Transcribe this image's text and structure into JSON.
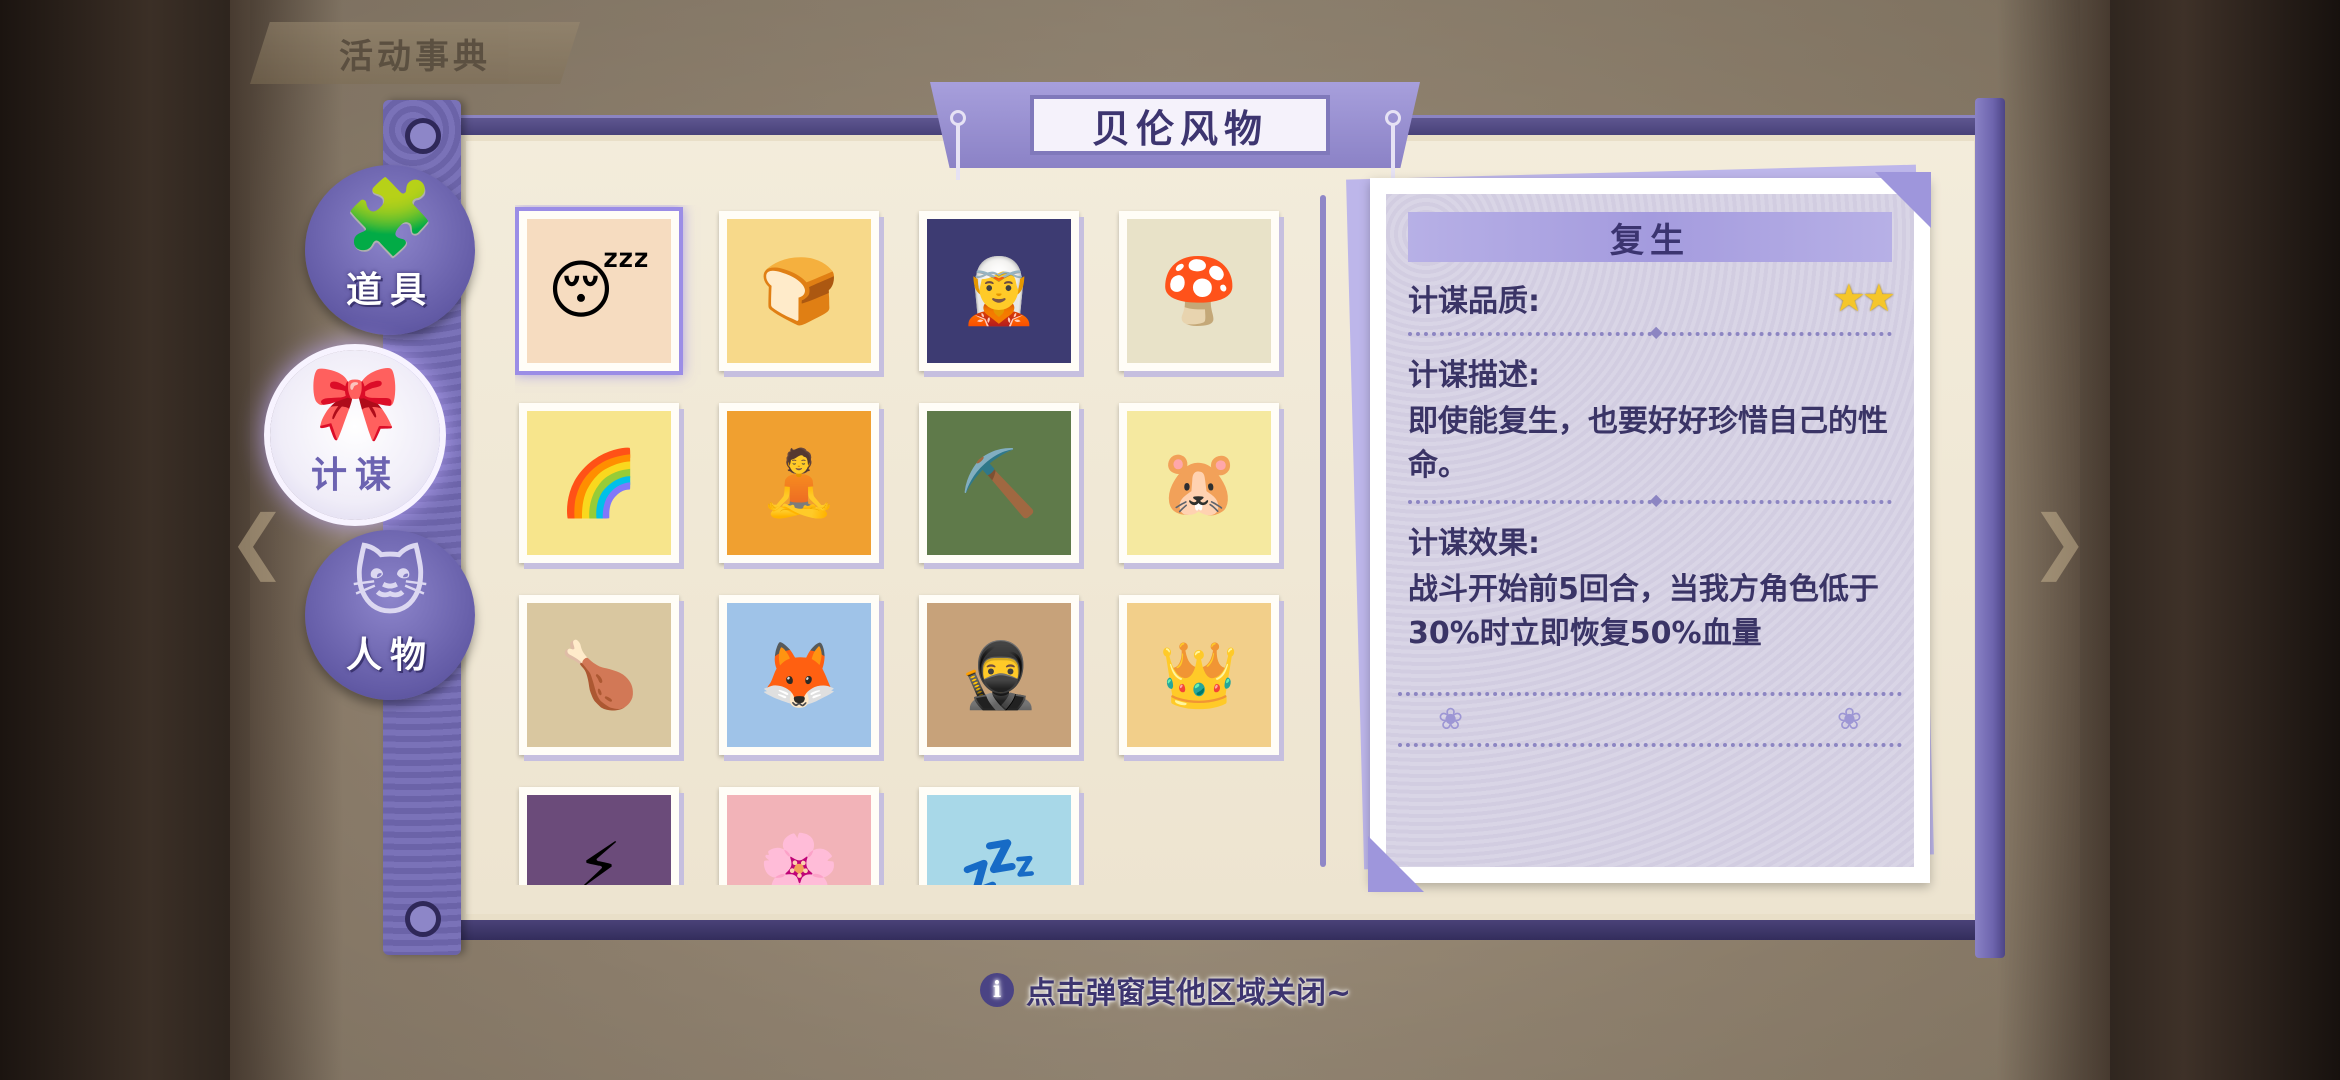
{
  "background": {
    "tab_label": "活动事典"
  },
  "title": "贝伦风物",
  "side_tabs": [
    {
      "label": "道具",
      "icon": "puzzle-icon",
      "glyph": "🧩",
      "active": false
    },
    {
      "label": "计谋",
      "icon": "bow-icon",
      "glyph": "🎀",
      "active": true
    },
    {
      "label": "人物",
      "icon": "cat-head-icon",
      "glyph": "🐱",
      "active": false
    }
  ],
  "cards": [
    {
      "name": "card-horned-maid",
      "glyph": "😴",
      "bg": "#f6dcc0"
    },
    {
      "name": "card-toast",
      "glyph": "🍞",
      "bg": "#f7d98a"
    },
    {
      "name": "card-purple-hair-girl",
      "glyph": "🧝",
      "bg": "#3d3b72"
    },
    {
      "name": "card-pink-hair-girl",
      "glyph": "🍄",
      "bg": "#e8e2c8"
    },
    {
      "name": "card-rainbow-horn",
      "glyph": "🌈",
      "bg": "#f7e58c"
    },
    {
      "name": "card-meditating-girl",
      "glyph": "🧘",
      "bg": "#f0a030"
    },
    {
      "name": "card-miners",
      "glyph": "⛏️",
      "bg": "#5f7a4a"
    },
    {
      "name": "card-white-creature",
      "glyph": "🐹",
      "bg": "#f5e9a0"
    },
    {
      "name": "card-food-feast",
      "glyph": "🍗",
      "bg": "#d9c7a0"
    },
    {
      "name": "card-fox-mask-girl",
      "glyph": "🦊",
      "bg": "#9fc3e8"
    },
    {
      "name": "card-masked-fighter",
      "glyph": "🥷",
      "bg": "#c7a27a"
    },
    {
      "name": "card-princess",
      "glyph": "👑",
      "bg": "#f2cf8a"
    },
    {
      "name": "card-lightning-girl",
      "glyph": "⚡",
      "bg": "#6b4b7a"
    },
    {
      "name": "card-pink-eye-girl",
      "glyph": "🌸",
      "bg": "#f2b3b8"
    },
    {
      "name": "card-sleeping-girl",
      "glyph": "💤",
      "bg": "#a8d8e8"
    }
  ],
  "detail": {
    "title": "复生",
    "quality_label": "计谋品质:",
    "stars": "★★",
    "star_count": 2,
    "description_label": "计谋描述:",
    "description": "即使能复生，也要好好珍惜自己的性命。",
    "effect_label": "计谋效果:",
    "effect": "战斗开始前5回合，当我方角色低于30%时立即恢复50%血量",
    "flourish_glyph": "❀"
  },
  "hint": "点击弹窗其他区域关闭~",
  "colors": {
    "accent": "#6c63b1",
    "frame": "#4a4384",
    "star": "#f5c62a"
  }
}
